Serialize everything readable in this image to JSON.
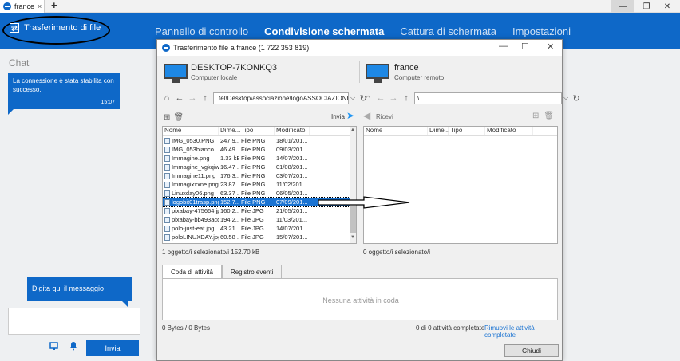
{
  "tabstrip": {
    "tab_label": "france",
    "add_tab": "+"
  },
  "window_controls": {
    "minimize": "—",
    "maximize": "❐",
    "close": "✕"
  },
  "topbar": {
    "title": "Trasferimento di file",
    "tabs": [
      {
        "label": "Pannello di controllo",
        "active": false
      },
      {
        "label": "Condivisione schermata",
        "active": true
      },
      {
        "label": "Cattura di schermata",
        "active": false
      },
      {
        "label": "Impostazioni",
        "active": false
      }
    ]
  },
  "chat": {
    "title": "Chat",
    "message": "La connessione è stata stabilita con successo.",
    "time": "15:07",
    "input_hint": "Digita qui il messaggio",
    "send_label": "Invia"
  },
  "ft": {
    "title": "Trasferimento file a france (1 722 353 819)",
    "controls": {
      "minimize": "—",
      "maximize": "☐",
      "close": "✕"
    },
    "local": {
      "name": "DESKTOP-7KONKQ3",
      "sub": "Computer locale",
      "path": "tel\\Desktop\\associazione\\logoASSOCIAZIONE"
    },
    "remote": {
      "name": "france",
      "sub": "Computer remoto",
      "path": "\\"
    },
    "send_label": "Invia",
    "receive_label": "Ricevi",
    "columns": {
      "name": "Nome",
      "size": "Dime...",
      "type": "Tipo",
      "modified": "Modificato"
    },
    "files": [
      {
        "name": "IMG_0530.PNG",
        "size": "247.9...",
        "type": "File PNG",
        "modified": "18/01/201...",
        "selected": false
      },
      {
        "name": "IMG_053bianco ...",
        "size": "46.49 ...",
        "type": "File PNG",
        "modified": "09/03/201...",
        "selected": false
      },
      {
        "name": "Immagine.png",
        "size": "1.33 kB",
        "type": "File PNG",
        "modified": "14/07/201...",
        "selected": false
      },
      {
        "name": "Immagine_vgkqiw...",
        "size": "16.47 ...",
        "type": "File PNG",
        "modified": "01/08/201...",
        "selected": false
      },
      {
        "name": "Immagine11.png",
        "size": "176.3...",
        "type": "File PNG",
        "modified": "03/07/201...",
        "selected": false
      },
      {
        "name": "Immagixxxne.png",
        "size": "23.87 ...",
        "type": "File PNG",
        "modified": "11/02/201...",
        "selected": false
      },
      {
        "name": "Linuxday06.png",
        "size": "63.37 ...",
        "type": "File PNG",
        "modified": "06/05/201...",
        "selected": false
      },
      {
        "name": "logobit01trasp.png",
        "size": "152.7...",
        "type": "File PNG",
        "modified": "07/09/201...",
        "selected": true
      },
      {
        "name": "pixabay-475664.jpg",
        "size": "160.2...",
        "type": "File JPG",
        "modified": "21/05/201...",
        "selected": false
      },
      {
        "name": "pixabay-bb493acd...",
        "size": "194.2...",
        "type": "File JPG",
        "modified": "11/03/201...",
        "selected": false
      },
      {
        "name": "polo-just-eat.jpg",
        "size": "43.21 ...",
        "type": "File JPG",
        "modified": "14/07/201...",
        "selected": false
      },
      {
        "name": "poloLINUXDAY.jpg",
        "size": "60.58 ...",
        "type": "File JPG",
        "modified": "15/07/201...",
        "selected": false
      }
    ],
    "left_status": "1 oggetto/i selezionato/i  152.70 kB",
    "right_status": "0 oggetto/i selezionato/i",
    "queue_tabs": [
      "Coda di attività",
      "Registro eventi"
    ],
    "queue_empty": "Nessuna attività in coda",
    "bytes": "0 Bytes / 0 Bytes",
    "done": "0 di 0 attività completate",
    "remove_done": "Rimuovi le attività completate",
    "close_label": "Chiudi"
  },
  "colors": {
    "brand_blue": "#0e68c8",
    "selection": "#1a73d2"
  },
  "icons": [
    "teamviewer-icon",
    "file-transfer-icon",
    "monitor-icon",
    "home-icon",
    "back-icon",
    "forward-icon",
    "up-icon",
    "refresh-icon",
    "new-folder-icon",
    "delete-icon",
    "send-arrow-icon",
    "receive-arrow-icon",
    "file-icon",
    "scroll-arrow-icon"
  ]
}
